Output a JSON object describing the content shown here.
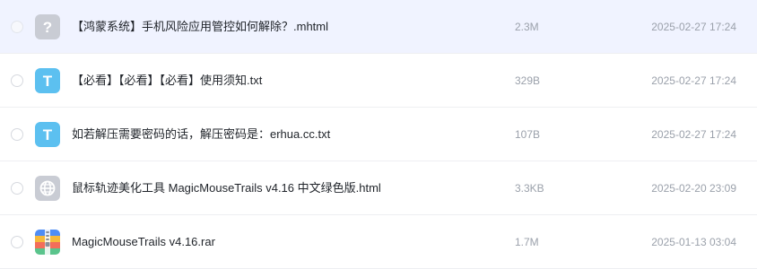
{
  "files": [
    {
      "name": "【鸿蒙系统】手机风险应用管控如何解除？.mhtml",
      "size": "2.3M",
      "date": "2025-02-27 17:24",
      "icon": "unknown-file-icon",
      "selected": true
    },
    {
      "name": "【必看】【必看】【必看】使用须知.txt",
      "size": "329B",
      "date": "2025-02-27 17:24",
      "icon": "text-file-icon",
      "selected": false
    },
    {
      "name": "如若解压需要密码的话，解压密码是：erhua.cc.txt",
      "size": "107B",
      "date": "2025-02-27 17:24",
      "icon": "text-file-icon",
      "selected": false
    },
    {
      "name": "鼠标轨迹美化工具 MagicMouseTrails v4.16 中文绿色版.html",
      "size": "3.3KB",
      "date": "2025-02-20 23:09",
      "icon": "web-file-icon",
      "selected": false
    },
    {
      "name": "MagicMouseTrails v4.16.rar",
      "size": "1.7M",
      "date": "2025-01-13 03:04",
      "icon": "archive-file-icon",
      "selected": false
    }
  ],
  "icon_glyphs": {
    "unknown": "?",
    "text": "T"
  },
  "colors": {
    "selected_row_bg": "#f0f3ff",
    "text_icon": "#5cc0f0",
    "unknown_icon": "#c9ccd4",
    "web_icon": "#c9ccd4",
    "primary_text": "#1f2329",
    "secondary_text": "#9ba1ab"
  }
}
